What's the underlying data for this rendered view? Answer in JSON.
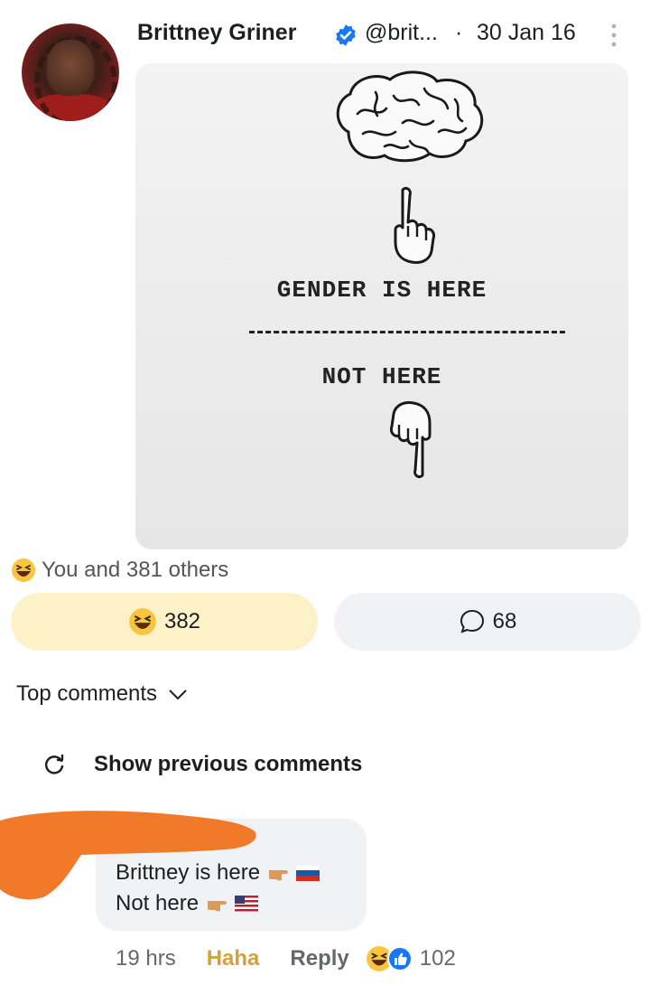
{
  "post": {
    "author_name": "Brittney Griner",
    "handle": "@brit...",
    "separator": "·",
    "date": "30 Jan 16",
    "image": {
      "line_top": "GENDER IS HERE",
      "line_bottom": "NOT HERE"
    }
  },
  "reactions": {
    "summary": "You and 381 others",
    "haha_count": "382",
    "comment_count": "68"
  },
  "comments_section": {
    "sort_label": "Top comments",
    "show_previous": "Show previous comments"
  },
  "comment": {
    "line1": "Brittney is here",
    "line2": "Not here",
    "time": "19 hrs",
    "haha_label": "Haha",
    "reply_label": "Reply",
    "reaction_count": "102"
  },
  "colors": {
    "haha_pill": "#fdf1c7",
    "comment_pill": "#f0f2f5",
    "haha_text": "#d6a13a",
    "verified": "#1877f2",
    "redaction": "#f07a2a"
  }
}
